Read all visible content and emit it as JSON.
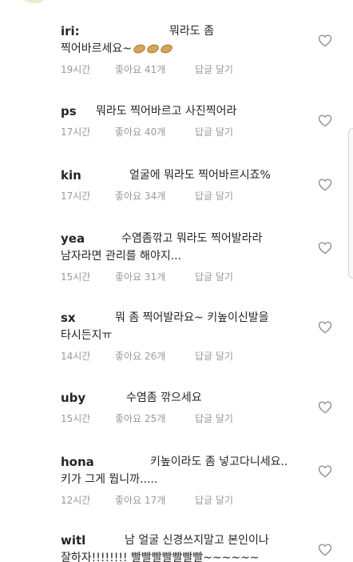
{
  "comments": [
    {
      "username": "iri:",
      "line1": "뭐라도 좀",
      "line2": "찍어바르세요~",
      "emoji_count": 3,
      "time": "19시간",
      "likes": "좋아요 41개",
      "reply": "답글 달기"
    },
    {
      "username": "ps",
      "line1": "뭐라도 찍어바르고 사진찍어라",
      "line2": "",
      "time": "17시간",
      "likes": "좋아요 40개",
      "reply": "답글 달기"
    },
    {
      "username": "kin",
      "line1": "얼굴에 뭐라도 찍어바르시죠%",
      "line2": "",
      "time": "17시간",
      "likes": "좋아요 34개",
      "reply": "답글 달기"
    },
    {
      "username": "yea",
      "line1": "수염좀깎고 뭐라도 찍어발라라",
      "line2": "남자라면 관리를 해야지...",
      "time": "15시간",
      "likes": "좋아요 31개",
      "reply": "답글 달기"
    },
    {
      "username": "sx",
      "line1": "뭐 좀 찍어발라요~ 키높이신발을",
      "line2": "타시든지ㅠ",
      "time": "14시간",
      "likes": "좋아요 26개",
      "reply": "답글 달기"
    },
    {
      "username": "uby",
      "line1": "수염좀 깎으세요",
      "line2": "",
      "time": "15시간",
      "likes": "좋아요 25개",
      "reply": "답글 달기"
    },
    {
      "username": "hona",
      "line1": "키높이라도 좀 넣고다니세요..",
      "line2": "키가 그게 뭡니까.....",
      "time": "12시간",
      "likes": "좋아요 17개",
      "reply": "답글 달기"
    },
    {
      "username": "witl",
      "line1": "남 얼굴 신경쓰지말고 본인이나",
      "line2": "잘하자!!!!!!!! 빨빨빨빨빨빨빨~~~~~~",
      "time": "",
      "likes": "",
      "reply": ""
    }
  ],
  "colors": {
    "text": "#262626",
    "meta": "#999999",
    "heart_stroke": "#8e8e8e"
  },
  "icons": {
    "like": "heart-outline-icon"
  }
}
